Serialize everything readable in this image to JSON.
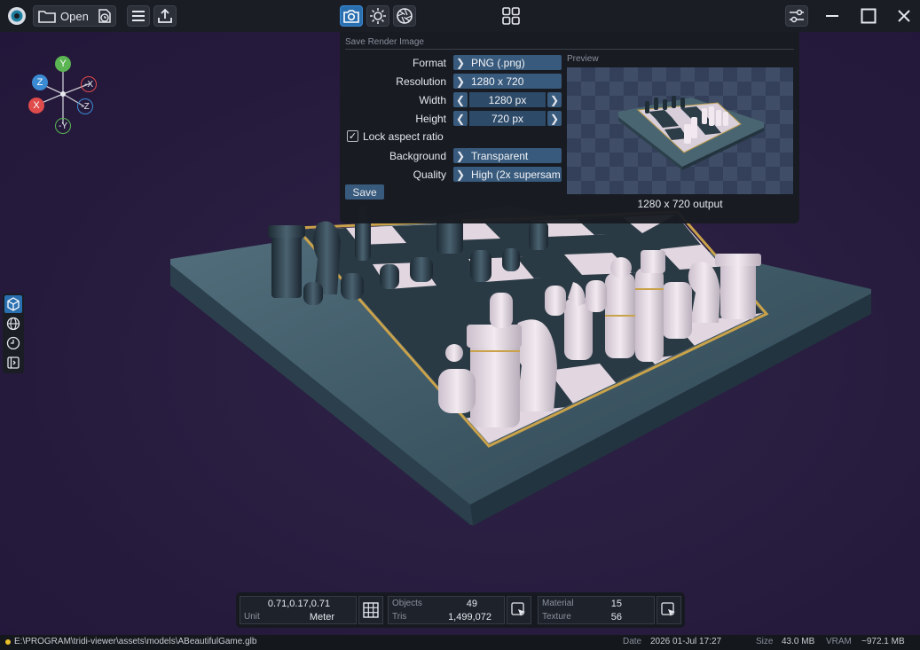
{
  "toolbar": {
    "open_label": "Open"
  },
  "gizmo": {
    "labels": {
      "y": "Y",
      "neg_y": "-Y",
      "x": "X",
      "neg_x": "-X",
      "z": "Z",
      "neg_z": "-Z"
    },
    "colors": {
      "y": "#5ab552",
      "x": "#e04b4b",
      "z": "#3b8bd4"
    }
  },
  "render_panel": {
    "title": "Save Render Image",
    "format_label": "Format",
    "format_value": "PNG (.png)",
    "resolution_label": "Resolution",
    "resolution_value": "1280 x 720",
    "width_label": "Width",
    "width_value": "1280 px",
    "height_label": "Height",
    "height_value": "720 px",
    "lock_label": "Lock aspect ratio",
    "lock_checked": true,
    "background_label": "Background",
    "background_value": "Transparent",
    "quality_label": "Quality",
    "quality_value": "High (2x supersam",
    "save_label": "Save",
    "preview_label": "Preview",
    "preview_caption": "1280 x 720 output"
  },
  "stats": {
    "coords": "0.71,0.17,0.71",
    "unit_label": "Unit",
    "unit_value": "Meter",
    "objects_label": "Objects",
    "objects_value": "49",
    "tris_label": "Tris",
    "tris_value": "1,499,072",
    "material_label": "Material",
    "material_value": "15",
    "texture_label": "Texture",
    "texture_value": "56"
  },
  "statusbar": {
    "path": "E:\\PROGRAM\\tridi-viewer\\assets\\models\\ABeautifulGame.glb",
    "date_label": "Date",
    "date_value": "2026 01-Jul 17:27",
    "size_label": "Size",
    "size_value": "43.0 MB",
    "vram_label": "VRAM",
    "vram_value": "~972.1 MB"
  },
  "colors": {
    "accent": "#2a6fb0",
    "field": "#385a7c",
    "background": "#271b3d",
    "status_dot": "#e8c02a"
  }
}
